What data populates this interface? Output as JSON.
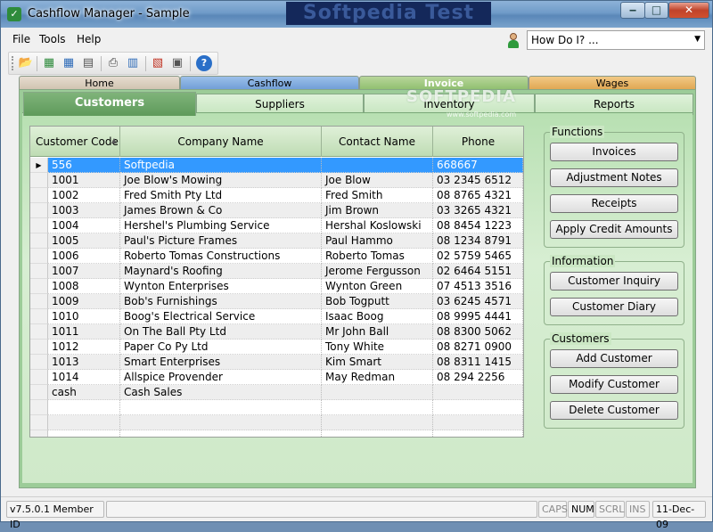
{
  "window": {
    "title": "Cashflow Manager - Sample",
    "watermark_top": "Softpedia Test",
    "minimize_glyph": "‒",
    "maximize_glyph": "□",
    "close_glyph": "✕"
  },
  "menu": {
    "file": "File",
    "tools": "Tools",
    "help": "Help"
  },
  "howdoi": {
    "value": "How Do I? ..."
  },
  "main_tabs": {
    "home": "Home",
    "cashflow": "Cashflow",
    "invoice": "Invoice",
    "wages": "Wages"
  },
  "sub_tabs": {
    "customers": "Customers",
    "suppliers": "Suppliers",
    "inventory": "Inventory",
    "reports": "Reports"
  },
  "watermark": {
    "center": "SOFTPEDIA",
    "url": "www.softpedia.com"
  },
  "grid": {
    "headers": {
      "code": "Customer Code",
      "company": "Company Name",
      "contact": "Contact Name",
      "phone": "Phone"
    },
    "rows": [
      {
        "code": "556",
        "company": "Softpedia",
        "contact": "",
        "phone": "668667"
      },
      {
        "code": "1001",
        "company": "Joe Blow's Mowing",
        "contact": "Joe Blow",
        "phone": "03 2345 6512"
      },
      {
        "code": "1002",
        "company": "Fred Smith Pty Ltd",
        "contact": "Fred Smith",
        "phone": "08 8765 4321"
      },
      {
        "code": "1003",
        "company": "James Brown & Co",
        "contact": "Jim Brown",
        "phone": "03 3265 4321"
      },
      {
        "code": "1004",
        "company": "Hershel's Plumbing Service",
        "contact": "Hershal Koslowski",
        "phone": "08 8454 1223"
      },
      {
        "code": "1005",
        "company": "Paul's Picture Frames",
        "contact": "Paul Hammo",
        "phone": "08 1234 8791"
      },
      {
        "code": "1006",
        "company": "Roberto Tomas Constructions",
        "contact": "Roberto Tomas",
        "phone": "02 5759 5465"
      },
      {
        "code": "1007",
        "company": "Maynard's Roofing",
        "contact": "Jerome Fergusson",
        "phone": "02 6464 5151"
      },
      {
        "code": "1008",
        "company": "Wynton Enterprises",
        "contact": "Wynton Green",
        "phone": "07 4513 3516"
      },
      {
        "code": "1009",
        "company": "Bob's Furnishings",
        "contact": "Bob Togputt",
        "phone": "03 6245 4571"
      },
      {
        "code": "1010",
        "company": "Boog's Electrical Service",
        "contact": "Isaac Boog",
        "phone": "08 9995 4441"
      },
      {
        "code": "1011",
        "company": "On The Ball Pty Ltd",
        "contact": "Mr John Ball",
        "phone": "08 8300 5062"
      },
      {
        "code": "1012",
        "company": "Paper Co Py Ltd",
        "contact": "Tony White",
        "phone": "08 8271 0900"
      },
      {
        "code": "1013",
        "company": "Smart Enterprises",
        "contact": "Kim Smart",
        "phone": "08 8311 1415"
      },
      {
        "code": "1014",
        "company": "Allspice Provender",
        "contact": "May Redman",
        "phone": "08 294 2256"
      },
      {
        "code": "cash",
        "company": "Cash Sales",
        "contact": "",
        "phone": ""
      },
      {
        "code": "",
        "company": "",
        "contact": "",
        "phone": ""
      },
      {
        "code": "",
        "company": "",
        "contact": "",
        "phone": ""
      },
      {
        "code": "",
        "company": "",
        "contact": "",
        "phone": ""
      }
    ]
  },
  "panel": {
    "functions": {
      "title": "Functions",
      "invoices": "Invoices",
      "adjustment_notes": "Adjustment Notes",
      "receipts": "Receipts",
      "apply_credit": "Apply Credit Amounts"
    },
    "information": {
      "title": "Information",
      "inquiry": "Customer Inquiry",
      "diary": "Customer Diary"
    },
    "customers": {
      "title": "Customers",
      "add": "Add Customer",
      "modify": "Modify Customer",
      "delete": "Delete Customer"
    }
  },
  "status": {
    "version": "v7.5.0.1 Member ID",
    "caps": "CAPS",
    "num": "NUM",
    "scrl": "SCRL",
    "ins": "INS",
    "date": "11-Dec-09"
  },
  "colors": {
    "selected_row": "#3399ff",
    "panel_green": "#9ccc98"
  }
}
